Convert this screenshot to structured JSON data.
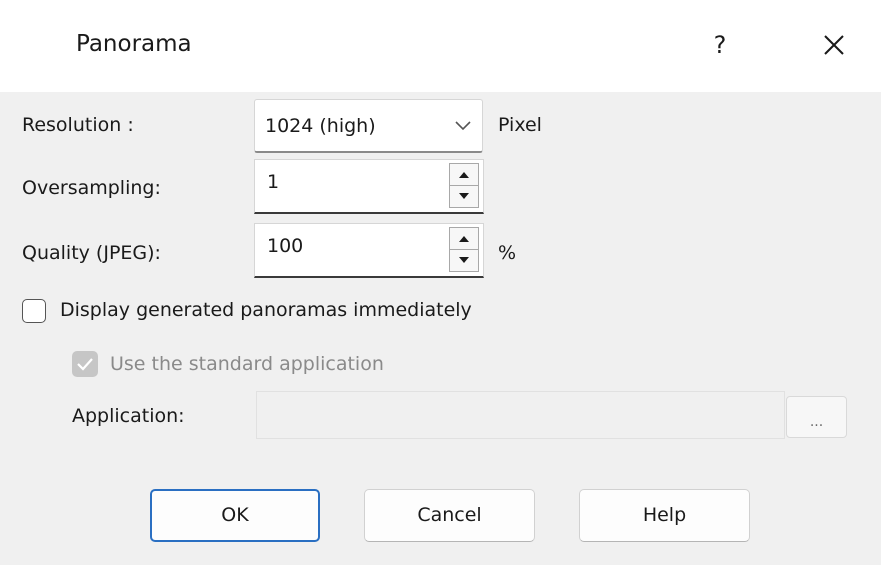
{
  "window": {
    "title": "Panorama",
    "help_glyph": "?",
    "close_icon": "close-icon"
  },
  "resolution": {
    "label": "Resolution :",
    "value": "1024 (high)",
    "unit": "Pixel"
  },
  "oversampling": {
    "label": "Oversampling:",
    "value": "1"
  },
  "quality": {
    "label": "Quality (JPEG):",
    "value": "100",
    "unit": "%"
  },
  "display_immediately": {
    "label": "Display generated panoramas immediately",
    "checked": false
  },
  "use_standard_app": {
    "label": "Use the standard application",
    "checked": true,
    "disabled": true
  },
  "application": {
    "label": "Application:",
    "value": "",
    "browse_label": "..."
  },
  "buttons": {
    "ok": "OK",
    "cancel": "Cancel",
    "help": "Help"
  },
  "colors": {
    "accent": "#2a6fc2",
    "dialog_bg": "#f0f0f0",
    "disabled_text": "#8a8a8a"
  }
}
